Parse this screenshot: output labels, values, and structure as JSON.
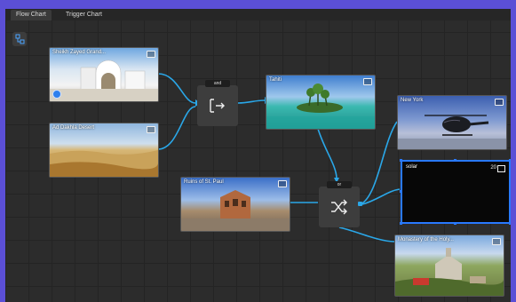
{
  "tabs": [
    {
      "label": "Flow Chart"
    },
    {
      "label": "Trigger Chart"
    }
  ],
  "gates": {
    "and": "and",
    "or": "or"
  },
  "cards": {
    "sheikh": {
      "label": "Sheikh Zayed Grand..."
    },
    "desert": {
      "label": "Ad Dakhla Desert"
    },
    "tahiti": {
      "label": "Tahiti"
    },
    "stpaul": {
      "label": "Ruins of St. Paul"
    },
    "newyork": {
      "label": "New York"
    },
    "solar": {
      "label": "solar",
      "count": "20"
    },
    "monastery": {
      "label": "Monastery of the Holy..."
    }
  },
  "colors": {
    "accent": "#2aa7e8",
    "selection": "#2979ff",
    "bg": "#2c2c2c",
    "outer": "#5b4fd6"
  }
}
